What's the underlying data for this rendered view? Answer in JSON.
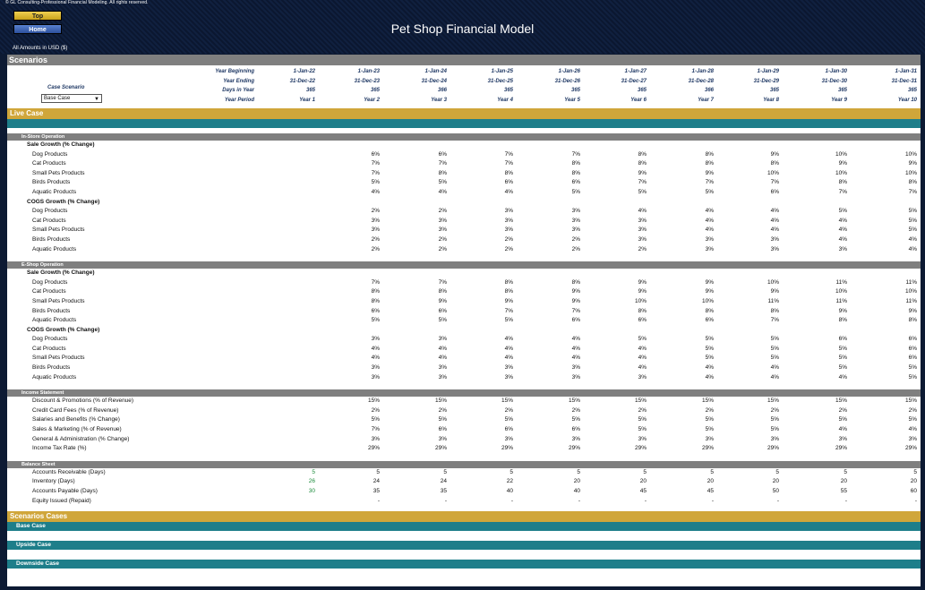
{
  "copyright": "© GL Consulting-Professional Financial Modeling. All rights reserved.",
  "buttons": {
    "top": "Top",
    "home": "Home"
  },
  "title": "Pet Shop Financial Model",
  "units": "All Amounts in  USD ($)",
  "scenarios_label": "Scenarios",
  "header_rows": [
    {
      "label": "Year Beginning",
      "values": [
        "1-Jan-22",
        "1-Jan-23",
        "1-Jan-24",
        "1-Jan-25",
        "1-Jan-26",
        "1-Jan-27",
        "1-Jan-28",
        "1-Jan-29",
        "1-Jan-30",
        "1-Jan-31"
      ]
    },
    {
      "label": "Year Ending",
      "values": [
        "31-Dec-22",
        "31-Dec-23",
        "31-Dec-24",
        "31-Dec-25",
        "31-Dec-26",
        "31-Dec-27",
        "31-Dec-28",
        "31-Dec-29",
        "31-Dec-30",
        "31-Dec-31"
      ]
    },
    {
      "label": "Days in Year",
      "values": [
        "365",
        "365",
        "366",
        "365",
        "365",
        "365",
        "366",
        "365",
        "365",
        "365"
      ]
    },
    {
      "label": "Year Period",
      "values": [
        "Year 1",
        "Year 2",
        "Year 3",
        "Year 4",
        "Year 5",
        "Year 6",
        "Year 7",
        "Year 8",
        "Year 9",
        "Year 10"
      ]
    }
  ],
  "case_scenario_label": "Case Scenario",
  "case_select_value": "Base Case",
  "live_case_label": "Live Case",
  "sections": [
    {
      "title": "In-Store Operation",
      "groups": [
        {
          "title": "Sale Growth (% Change)",
          "rows": [
            {
              "label": "Dog Products",
              "values": [
                "6%",
                "6%",
                "7%",
                "7%",
                "8%",
                "8%",
                "9%",
                "10%",
                "10%"
              ]
            },
            {
              "label": "Cat Products",
              "values": [
                "7%",
                "7%",
                "7%",
                "8%",
                "8%",
                "8%",
                "8%",
                "9%",
                "9%"
              ]
            },
            {
              "label": "Small Pets Products",
              "values": [
                "7%",
                "8%",
                "8%",
                "8%",
                "9%",
                "9%",
                "10%",
                "10%",
                "10%"
              ]
            },
            {
              "label": "Birds Products",
              "values": [
                "5%",
                "5%",
                "6%",
                "6%",
                "7%",
                "7%",
                "7%",
                "8%",
                "8%"
              ]
            },
            {
              "label": "Aquatic Products",
              "values": [
                "4%",
                "4%",
                "4%",
                "5%",
                "5%",
                "5%",
                "6%",
                "7%",
                "7%"
              ]
            }
          ]
        },
        {
          "title": "COGS Growth (% Change)",
          "rows": [
            {
              "label": "Dog Products",
              "values": [
                "2%",
                "2%",
                "3%",
                "3%",
                "4%",
                "4%",
                "4%",
                "5%",
                "5%"
              ]
            },
            {
              "label": "Cat Products",
              "values": [
                "3%",
                "3%",
                "3%",
                "3%",
                "3%",
                "4%",
                "4%",
                "4%",
                "5%"
              ]
            },
            {
              "label": "Small Pets Products",
              "values": [
                "3%",
                "3%",
                "3%",
                "3%",
                "3%",
                "4%",
                "4%",
                "4%",
                "5%"
              ]
            },
            {
              "label": "Birds Products",
              "values": [
                "2%",
                "2%",
                "2%",
                "2%",
                "3%",
                "3%",
                "3%",
                "4%",
                "4%"
              ]
            },
            {
              "label": "Aquatic Products",
              "values": [
                "2%",
                "2%",
                "2%",
                "2%",
                "2%",
                "3%",
                "3%",
                "3%",
                "4%"
              ]
            }
          ]
        }
      ]
    },
    {
      "title": "E-Shop Operation",
      "groups": [
        {
          "title": "Sale Growth (% Change)",
          "rows": [
            {
              "label": "Dog Products",
              "values": [
                "7%",
                "7%",
                "8%",
                "8%",
                "9%",
                "9%",
                "10%",
                "11%",
                "11%"
              ]
            },
            {
              "label": "Cat Products",
              "values": [
                "8%",
                "8%",
                "8%",
                "9%",
                "9%",
                "9%",
                "9%",
                "10%",
                "10%"
              ]
            },
            {
              "label": "Small Pets Products",
              "values": [
                "8%",
                "9%",
                "9%",
                "9%",
                "10%",
                "10%",
                "11%",
                "11%",
                "11%"
              ]
            },
            {
              "label": "Birds Products",
              "values": [
                "6%",
                "6%",
                "7%",
                "7%",
                "8%",
                "8%",
                "8%",
                "9%",
                "9%"
              ]
            },
            {
              "label": "Aquatic Products",
              "values": [
                "5%",
                "5%",
                "5%",
                "6%",
                "6%",
                "6%",
                "7%",
                "8%",
                "8%"
              ]
            }
          ]
        },
        {
          "title": "COGS Growth (% Change)",
          "rows": [
            {
              "label": "Dog Products",
              "values": [
                "3%",
                "3%",
                "4%",
                "4%",
                "5%",
                "5%",
                "5%",
                "6%",
                "6%"
              ]
            },
            {
              "label": "Cat Products",
              "values": [
                "4%",
                "4%",
                "4%",
                "4%",
                "4%",
                "5%",
                "5%",
                "5%",
                "6%"
              ]
            },
            {
              "label": "Small Pets Products",
              "values": [
                "4%",
                "4%",
                "4%",
                "4%",
                "4%",
                "5%",
                "5%",
                "5%",
                "6%"
              ]
            },
            {
              "label": "Birds Products",
              "values": [
                "3%",
                "3%",
                "3%",
                "3%",
                "4%",
                "4%",
                "4%",
                "5%",
                "5%"
              ]
            },
            {
              "label": "Aquatic Products",
              "values": [
                "3%",
                "3%",
                "3%",
                "3%",
                "3%",
                "4%",
                "4%",
                "4%",
                "5%"
              ]
            }
          ]
        }
      ]
    },
    {
      "title": "Income Statement",
      "groups": [
        {
          "title": "",
          "rows": [
            {
              "label": "Discount & Promotions (% of Revenue)",
              "values": [
                "15%",
                "15%",
                "15%",
                "15%",
                "15%",
                "15%",
                "15%",
                "15%",
                "15%"
              ]
            },
            {
              "label": "Credit Card Fees (% of Revenue)",
              "values": [
                "2%",
                "2%",
                "2%",
                "2%",
                "2%",
                "2%",
                "2%",
                "2%",
                "2%"
              ]
            },
            {
              "label": "Salaries and Benefits (% Change)",
              "values": [
                "5%",
                "5%",
                "5%",
                "5%",
                "5%",
                "5%",
                "5%",
                "5%",
                "5%"
              ]
            },
            {
              "label": "Sales & Marketing (% of Revenue)",
              "values": [
                "7%",
                "6%",
                "6%",
                "6%",
                "5%",
                "5%",
                "5%",
                "4%",
                "4%"
              ]
            },
            {
              "label": "General & Administration (% Change)",
              "values": [
                "3%",
                "3%",
                "3%",
                "3%",
                "3%",
                "3%",
                "3%",
                "3%",
                "3%"
              ]
            },
            {
              "label": "Income Tax Rate (%)",
              "values": [
                "29%",
                "29%",
                "29%",
                "29%",
                "29%",
                "29%",
                "29%",
                "29%",
                "29%"
              ]
            }
          ]
        }
      ]
    },
    {
      "title": "Balance Sheet",
      "groups": [
        {
          "title": "",
          "rows": [
            {
              "label": "Accounts Receivable (Days)",
              "first": "5",
              "values": [
                "5",
                "5",
                "5",
                "5",
                "5",
                "5",
                "5",
                "5",
                "5"
              ]
            },
            {
              "label": "Inventory (Days)",
              "first": "26",
              "values": [
                "24",
                "24",
                "22",
                "20",
                "20",
                "20",
                "20",
                "20",
                "20"
              ]
            },
            {
              "label": "Accounts Payable (Days)",
              "first": "30",
              "values": [
                "35",
                "35",
                "40",
                "40",
                "45",
                "45",
                "50",
                "55",
                "60"
              ]
            },
            {
              "label": "Equity Issued (Repaid)",
              "first": "",
              "values": [
                "-",
                "-",
                "-",
                "-",
                "-",
                "-",
                "-",
                "-",
                "-"
              ]
            }
          ]
        }
      ]
    }
  ],
  "scenarios_cases_label": "Scenarios Cases",
  "cases": [
    "Base Case",
    "Upside Case",
    "Downside Case"
  ]
}
